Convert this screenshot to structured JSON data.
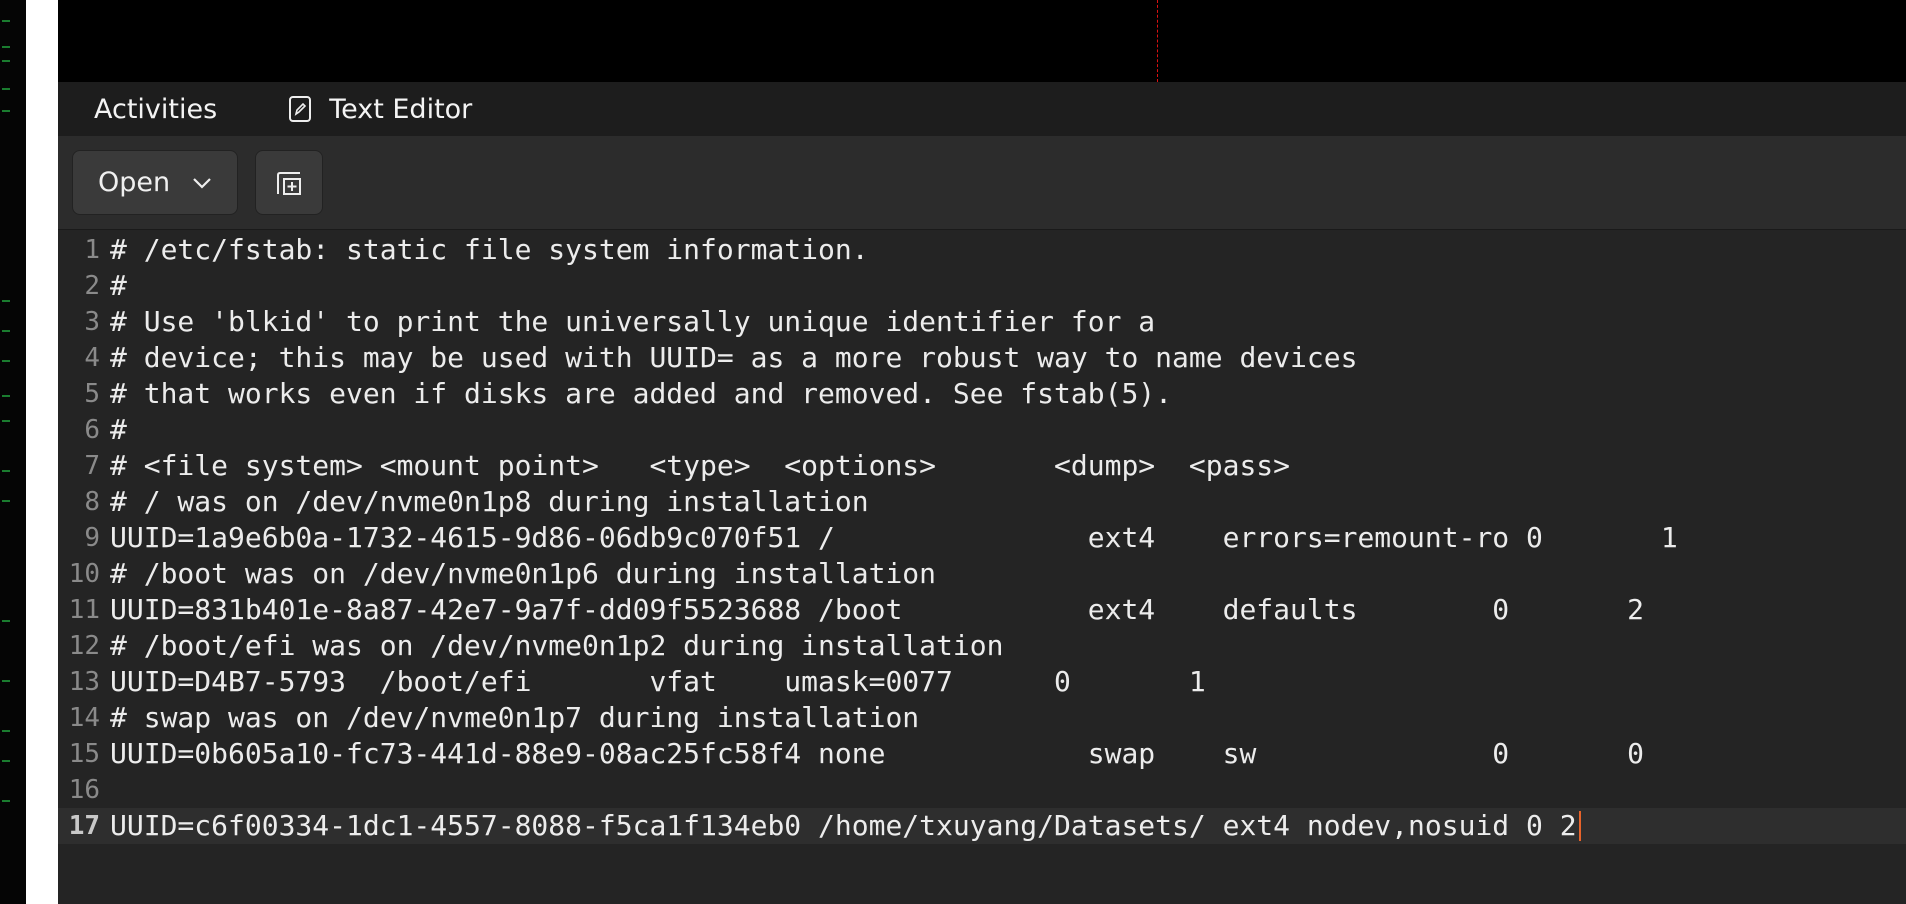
{
  "topbar": {
    "activities": "Activities",
    "app_name": "Text Editor"
  },
  "headerbar": {
    "open_label": "Open"
  },
  "editor": {
    "lines": [
      {
        "n": "1",
        "text": "# /etc/fstab: static file system information."
      },
      {
        "n": "2",
        "text": "#"
      },
      {
        "n": "3",
        "text": "# Use 'blkid' to print the universally unique identifier for a"
      },
      {
        "n": "4",
        "text": "# device; this may be used with UUID= as a more robust way to name devices"
      },
      {
        "n": "5",
        "text": "# that works even if disks are added and removed. See fstab(5)."
      },
      {
        "n": "6",
        "text": "#"
      },
      {
        "n": "7",
        "text": "# <file system> <mount point>   <type>  <options>       <dump>  <pass>"
      },
      {
        "n": "8",
        "text": "# / was on /dev/nvme0n1p8 during installation"
      },
      {
        "n": "9",
        "text": "UUID=1a9e6b0a-1732-4615-9d86-06db9c070f51 /               ext4    errors=remount-ro 0       1"
      },
      {
        "n": "10",
        "text": "# /boot was on /dev/nvme0n1p6 during installation"
      },
      {
        "n": "11",
        "text": "UUID=831b401e-8a87-42e7-9a7f-dd09f5523688 /boot           ext4    defaults        0       2"
      },
      {
        "n": "12",
        "text": "# /boot/efi was on /dev/nvme0n1p2 during installation"
      },
      {
        "n": "13",
        "text": "UUID=D4B7-5793  /boot/efi       vfat    umask=0077      0       1"
      },
      {
        "n": "14",
        "text": "# swap was on /dev/nvme0n1p7 during installation"
      },
      {
        "n": "15",
        "text": "UUID=0b605a10-fc73-441d-88e9-08ac25fc58f4 none            swap    sw              0       0"
      },
      {
        "n": "16",
        "text": ""
      },
      {
        "n": "17",
        "text": "UUID=c6f00334-1dc1-4557-8088-f5ca1f134eb0 /home/txuyang/Datasets/ ext4 nodev,nosuid 0 2"
      }
    ]
  },
  "colors": {
    "cursor": "#e8632a",
    "editor_bg": "#242424",
    "current_line": "#2e2e2e"
  }
}
